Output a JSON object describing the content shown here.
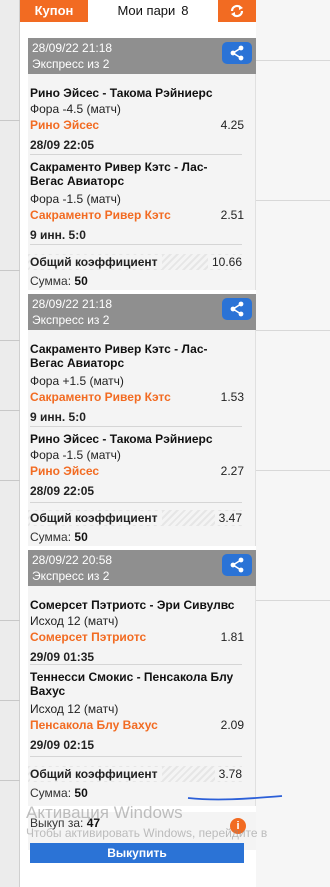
{
  "tabs": {
    "coupon_label": "Купон",
    "mybets_label": "Мои пари",
    "mybets_count": "8",
    "refresh_icon": "refresh-icon"
  },
  "bets": [
    {
      "datetime": "28/09/22 21:18",
      "type": "Экспресс из 2",
      "events": [
        {
          "title": "Рино Эйсес - Такома Рэйниерс",
          "market": "Фора -4.5 (матч)",
          "pick": "Рино Эйсес",
          "odds": "4.25",
          "info": "28/09 22:05"
        },
        {
          "title": "Сакраменто Ривер Кэтс - Лас-Вегас Авиаторс",
          "market": "Фора -1.5 (матч)",
          "pick": "Сакраменто Ривер Кэтс",
          "odds": "2.51",
          "info": "9 инн. 5:0"
        }
      ],
      "total_label": "Общий коэффициент",
      "total_odds": "10.66",
      "sum_label": "Сумма:",
      "sum_value": "50"
    },
    {
      "datetime": "28/09/22 21:18",
      "type": "Экспресс из 2",
      "events": [
        {
          "title": "Сакраменто Ривер Кэтс - Лас-Вегас Авиаторс",
          "market": "Фора +1.5 (матч)",
          "pick": "Сакраменто Ривер Кэтс",
          "odds": "1.53",
          "info": "9 инн. 5:0"
        },
        {
          "title": "Рино Эйсес - Такома Рэйниерс",
          "market": "Фора -1.5 (матч)",
          "pick": "Рино Эйсес",
          "odds": "2.27",
          "info": "28/09 22:05"
        }
      ],
      "total_label": "Общий коэффициент",
      "total_odds": "3.47",
      "sum_label": "Сумма:",
      "sum_value": "50"
    },
    {
      "datetime": "28/09/22 20:58",
      "type": "Экспресс из 2",
      "events": [
        {
          "title": "Сомерсет Пэтриотс - Эри Сивулвс",
          "market": "Исход 12 (матч)",
          "pick": "Сомерсет Пэтриотс",
          "odds": "1.81",
          "info": "29/09 01:35"
        },
        {
          "title": "Теннесси Смокис - Пенсакола Блу Вахус",
          "market": "Исход 12 (матч)",
          "pick": "Пенсакола Блу Вахус",
          "odds": "2.09",
          "info": "29/09 02:15"
        }
      ],
      "total_label": "Общий коэффициент",
      "total_odds": "3.78",
      "sum_label": "Сумма:",
      "sum_value": "50"
    }
  ],
  "cashout": {
    "label": "Выкуп за:",
    "value": "47",
    "button_label": "Выкупить",
    "info_glyph": "i"
  },
  "windows_watermark": {
    "title": "Активация Windows",
    "subtitle": "Чтобы активировать Windows, перейдите в"
  },
  "colors": {
    "accent": "#f26b22",
    "header_gray": "#8f8f8f",
    "button_blue": "#2b73d6"
  }
}
